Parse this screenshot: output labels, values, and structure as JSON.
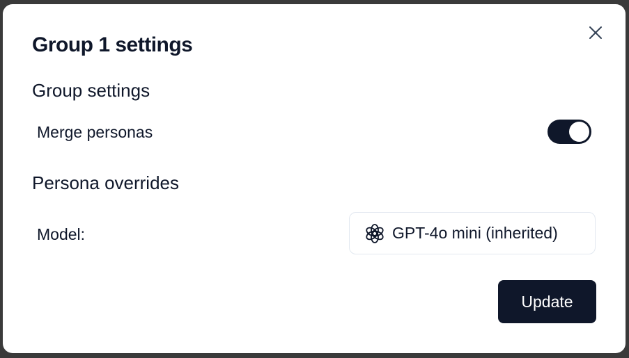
{
  "dialog": {
    "title": "Group 1 settings",
    "close_icon": "close-icon"
  },
  "group_settings": {
    "heading": "Group settings",
    "merge_personas": {
      "label": "Merge personas",
      "enabled": true
    }
  },
  "persona_overrides": {
    "heading": "Persona overrides",
    "model": {
      "label": "Model:",
      "value": "GPT-4o mini (inherited)",
      "icon": "openai-logo-icon"
    }
  },
  "actions": {
    "update_label": "Update"
  },
  "colors": {
    "primary": "#0f172a",
    "border": "#e2e8f0",
    "background": "#ffffff"
  }
}
